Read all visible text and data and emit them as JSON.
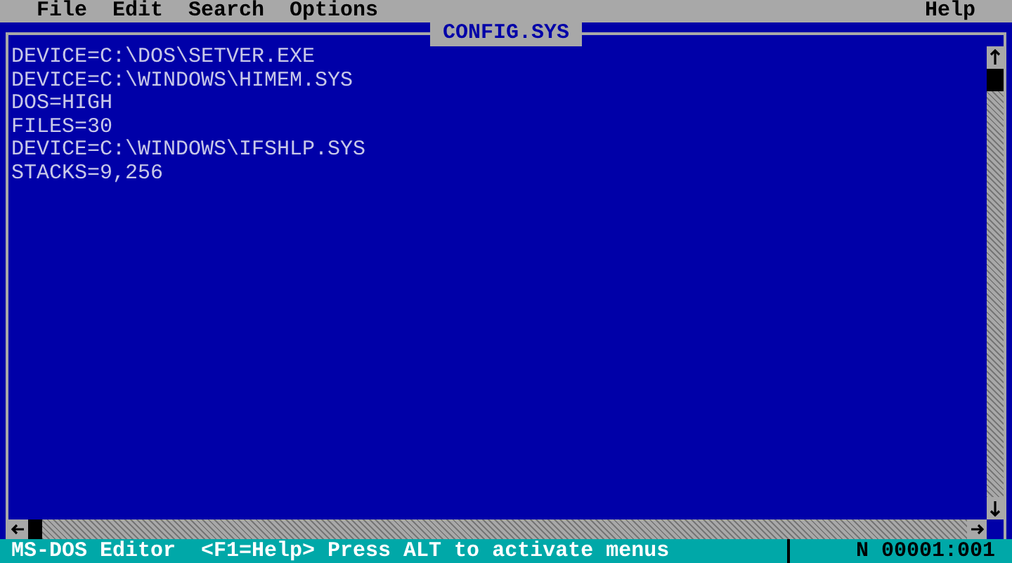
{
  "menu_bar": {
    "left": [
      "File",
      "Edit",
      "Search",
      "Options"
    ],
    "right": [
      "Help"
    ]
  },
  "editor": {
    "title": "CONFIG.SYS",
    "lines": [
      "DEVICE=C:\\DOS\\SETVER.EXE",
      "DEVICE=C:\\WINDOWS\\HIMEM.SYS",
      "DOS=HIGH",
      "FILES=30",
      "DEVICE=C:\\WINDOWS\\IFSHLP.SYS",
      "STACKS=9,256"
    ]
  },
  "status_bar": {
    "app": "MS-DOS Editor",
    "hint": "<F1=Help> Press ALT to activate menus",
    "mode": "N",
    "position": "00001:001"
  }
}
